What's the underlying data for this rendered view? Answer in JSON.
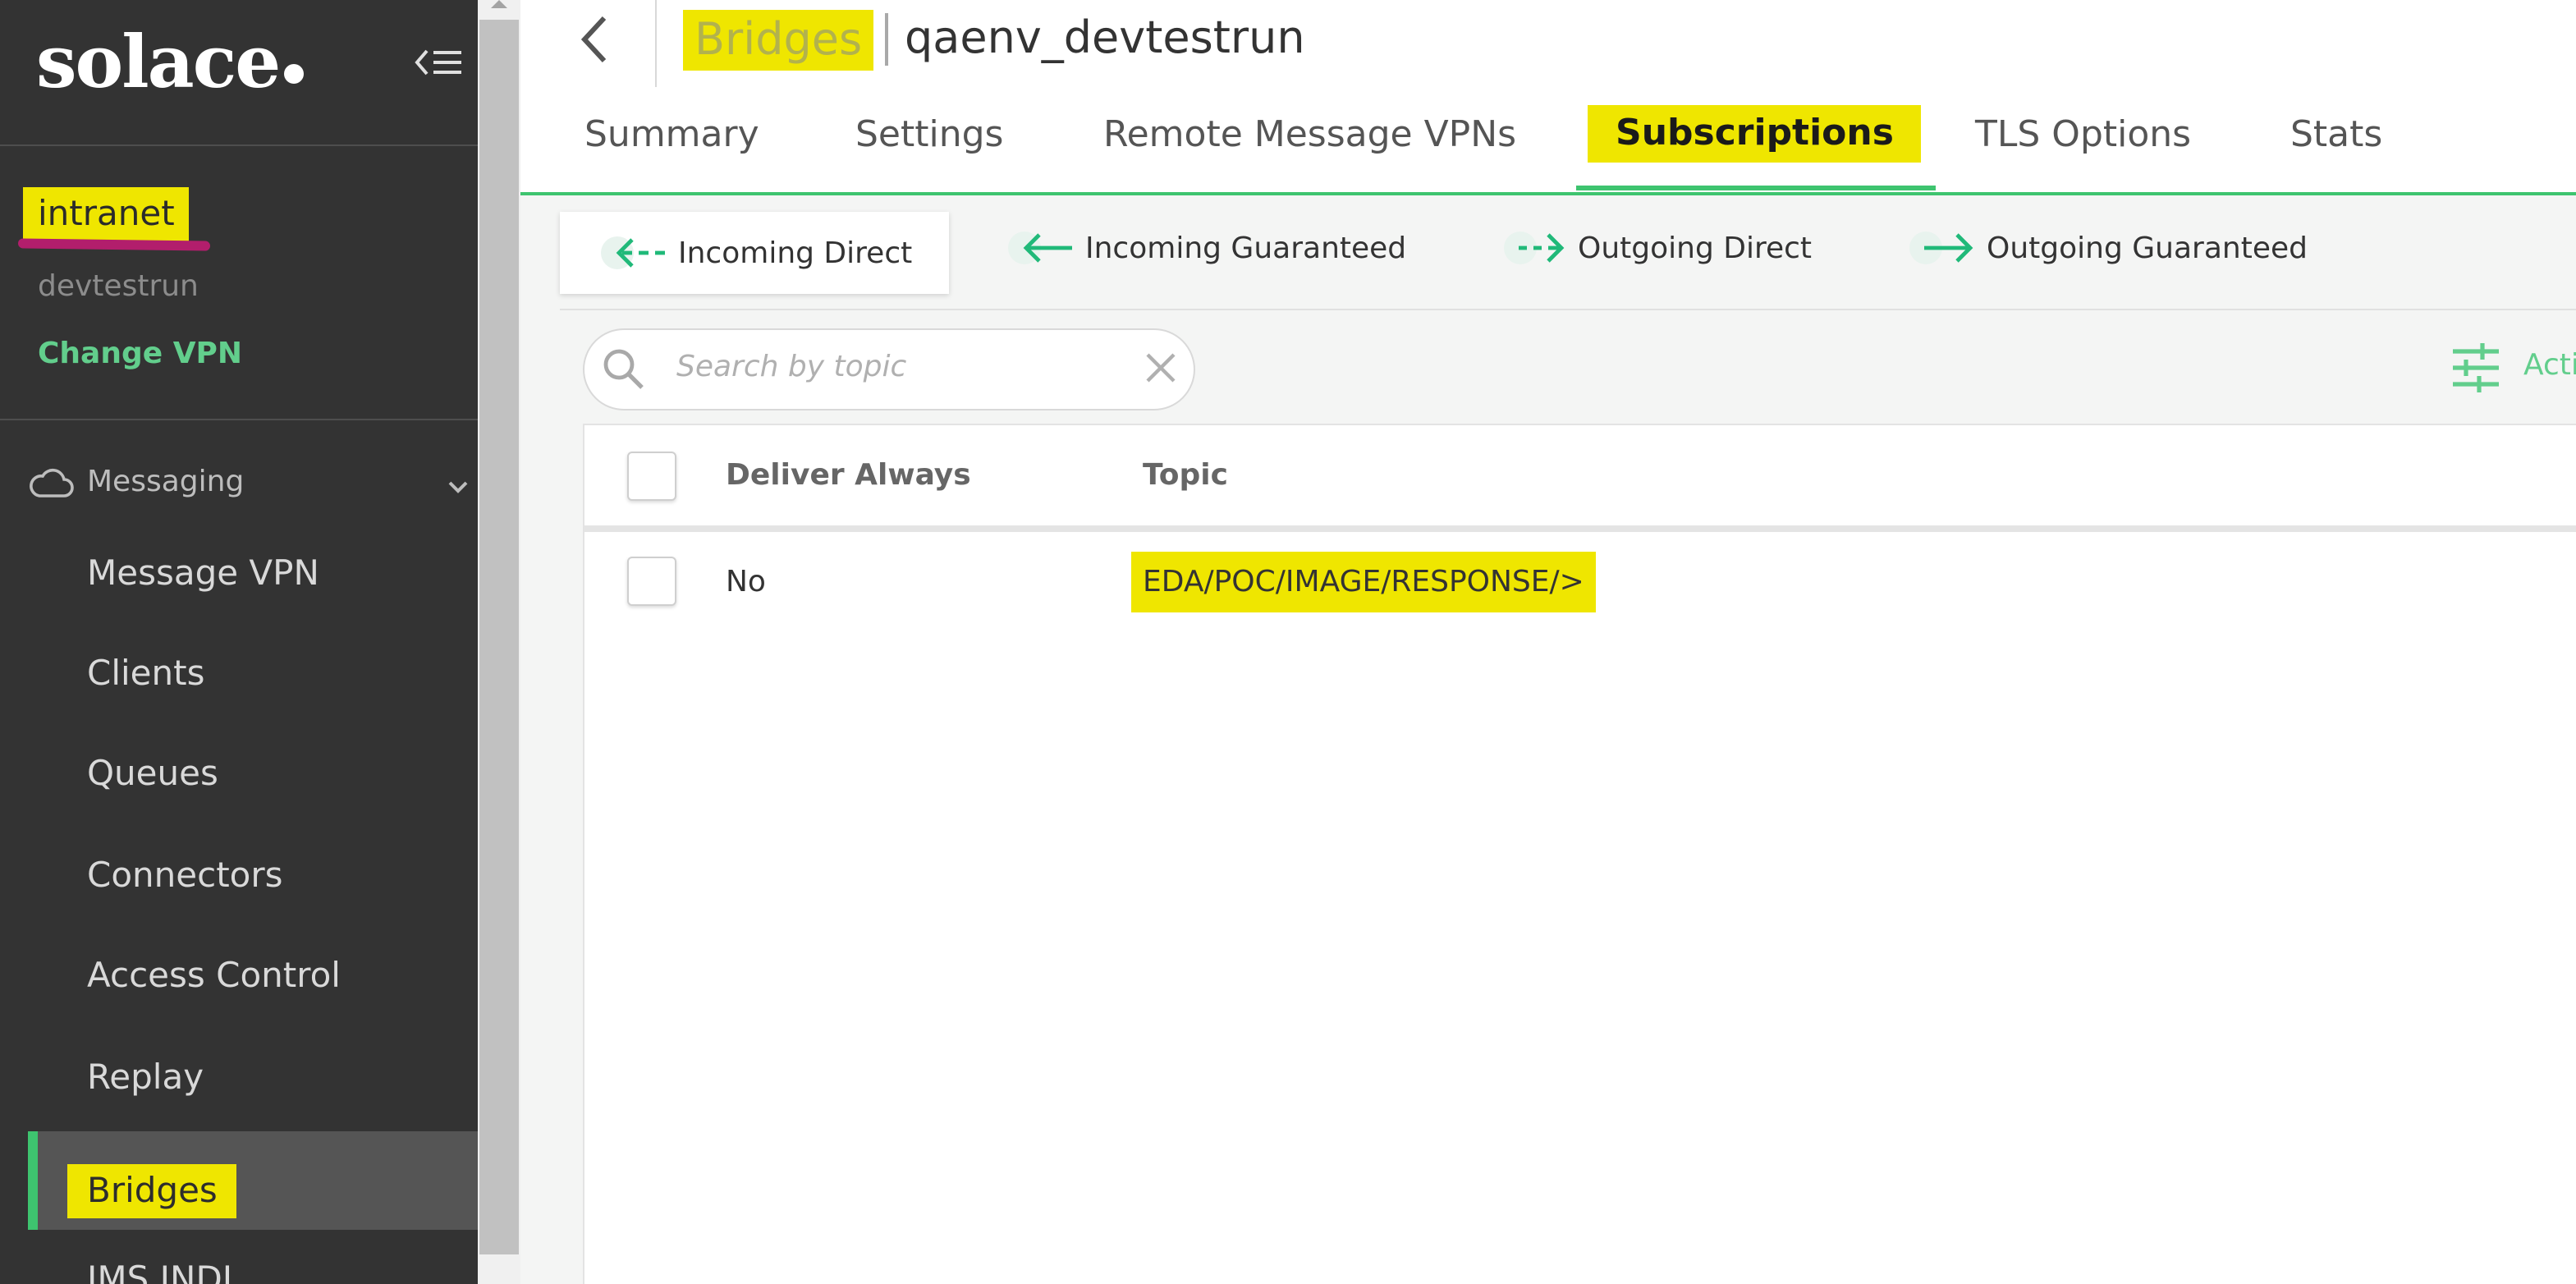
{
  "brand": {
    "logo_text": "solace"
  },
  "sidebar": {
    "vpn_name": "intranet",
    "vpn_sub": "devtestrun",
    "change_vpn": "Change VPN",
    "group_label": "Messaging",
    "items": [
      {
        "label": "Message VPN"
      },
      {
        "label": "Clients"
      },
      {
        "label": "Queues"
      },
      {
        "label": "Connectors"
      },
      {
        "label": "Access Control"
      },
      {
        "label": "Replay"
      },
      {
        "label": "Bridges",
        "active": true
      },
      {
        "label": "JMS JNDI"
      }
    ]
  },
  "header": {
    "breadcrumb": "Bridges",
    "title": "qaenv_devtestrun"
  },
  "tabs": [
    "Summary",
    "Settings",
    "Remote Message VPNs",
    "Subscriptions",
    "TLS Options",
    "Stats"
  ],
  "active_tab": "Subscriptions",
  "subtabs": [
    {
      "label": "Incoming Direct",
      "icon": "arrow-left-dashed-icon",
      "active": true
    },
    {
      "label": "Incoming Guaranteed",
      "icon": "arrow-left-icon"
    },
    {
      "label": "Outgoing Direct",
      "icon": "arrow-right-dashed-icon"
    },
    {
      "label": "Outgoing Guaranteed",
      "icon": "arrow-right-icon"
    }
  ],
  "search": {
    "placeholder": "Search by topic",
    "value": ""
  },
  "actions_label": "Acti",
  "table": {
    "columns": [
      "Deliver Always",
      "Topic"
    ],
    "rows": [
      {
        "deliver_always": "No",
        "topic": "EDA/POC/IMAGE/RESPONSE/>"
      }
    ]
  },
  "colors": {
    "sidebar_bg": "#333333",
    "accent_green": "#3ec46f",
    "highlight_yellow": "#efe600",
    "underline_magenta": "#b21e6c"
  }
}
